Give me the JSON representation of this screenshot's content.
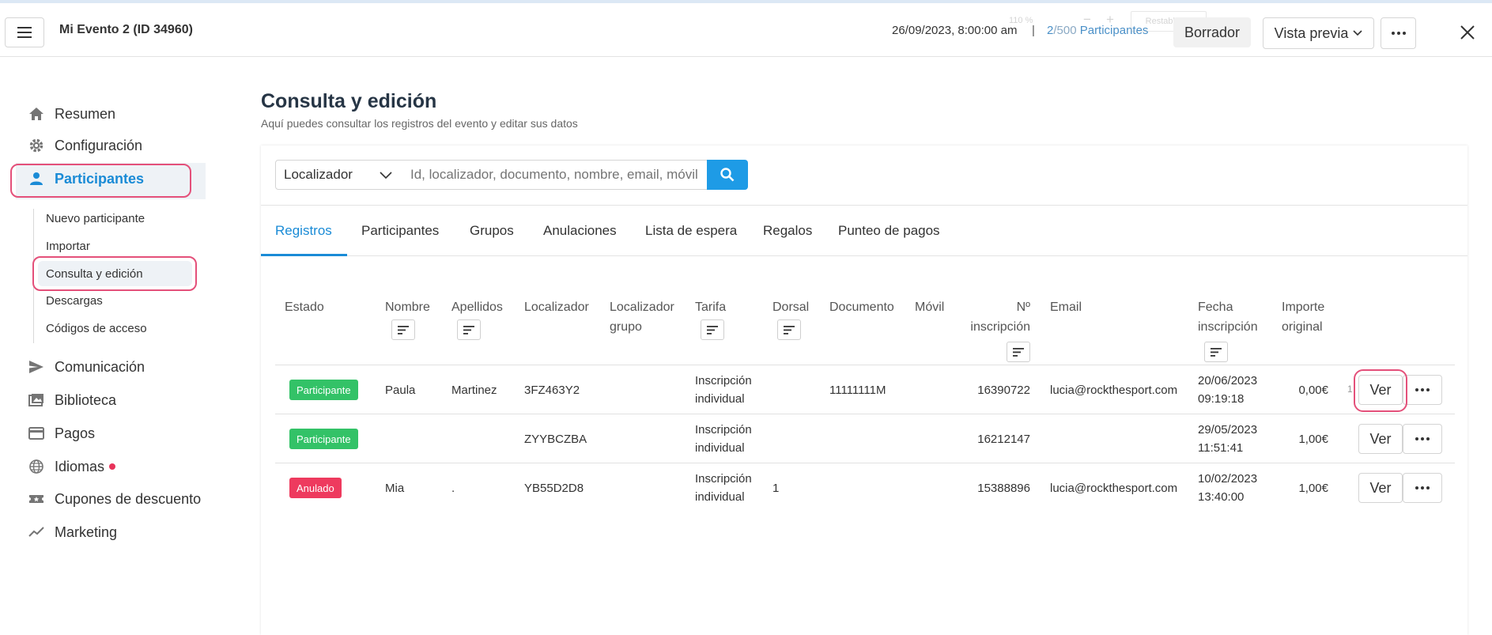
{
  "header": {
    "event_title": "Mi Evento 2 (ID 34960)",
    "date": "26/09/2023, 8:00:00 am",
    "separator": "|",
    "count_current": "2",
    "count_total": "/500",
    "count_label": "Participantes",
    "zoom_level": "110 %",
    "zoom_minus": "−",
    "zoom_plus": "+",
    "zoom_reset": "Restablecer",
    "draft_label": "Borrador",
    "preview_label": "Vista previa"
  },
  "sidebar": {
    "items": [
      {
        "label": "Resumen",
        "icon": "home-icon"
      },
      {
        "label": "Configuración",
        "icon": "gear-icon"
      },
      {
        "label": "Participantes",
        "icon": "person-icon"
      },
      {
        "label": "Comunicación",
        "icon": "send-icon"
      },
      {
        "label": "Biblioteca",
        "icon": "images-icon"
      },
      {
        "label": "Pagos",
        "icon": "card-icon"
      },
      {
        "label": "Idiomas",
        "icon": "globe-icon"
      },
      {
        "label": "Cupones de descuento",
        "icon": "ticket-icon"
      },
      {
        "label": "Marketing",
        "icon": "trend-icon"
      }
    ],
    "subitems": [
      {
        "label": "Nuevo participante"
      },
      {
        "label": "Importar"
      },
      {
        "label": "Consulta y edición"
      },
      {
        "label": "Descargas"
      },
      {
        "label": "Códigos de acceso"
      }
    ]
  },
  "main": {
    "title": "Consulta y edición",
    "subtitle": "Aquí puedes consultar los registros del evento y editar sus datos",
    "search": {
      "filter_value": "Localizador",
      "placeholder": "Id, localizador, documento, nombre, email, móvil"
    },
    "tabs": [
      {
        "label": "Registros"
      },
      {
        "label": "Participantes"
      },
      {
        "label": "Grupos"
      },
      {
        "label": "Anulaciones"
      },
      {
        "label": "Lista de espera"
      },
      {
        "label": "Regalos"
      },
      {
        "label": "Punteo de pagos"
      }
    ],
    "columns": {
      "estado": "Estado",
      "nombre": "Nombre",
      "apellidos": "Apellidos",
      "localizador": "Localizador",
      "localizador_grupo_1": "Localizador",
      "localizador_grupo_2": "grupo",
      "tarifa": "Tarifa",
      "dorsal": "Dorsal",
      "documento": "Documento",
      "movil": "Móvil",
      "inscripcion_1": "Nº",
      "inscripcion_2": "inscripción",
      "email": "Email",
      "fecha_1": "Fecha",
      "fecha_2": "inscripción",
      "importe_1": "Importe",
      "importe_2": "original"
    },
    "rows": [
      {
        "estado": "Participante",
        "estado_color": "#33c267",
        "nombre": "Paula",
        "apellidos": "Martinez",
        "localizador": "3FZ463Y2",
        "tarifa_1": "Inscripción",
        "tarifa_2": "individual",
        "dorsal": "",
        "documento": "11111111M",
        "movil": "",
        "inscripcion": "16390722",
        "email": "lucia@rockthesport.com",
        "fecha_1": "20/06/2023",
        "fecha_2": "09:19:18",
        "importe": "0,00€",
        "overflow": "1",
        "action": "Ver"
      },
      {
        "estado": "Participante",
        "estado_color": "#33c267",
        "nombre": "",
        "apellidos": "",
        "localizador": "ZYYBCZBA",
        "tarifa_1": "Inscripción",
        "tarifa_2": "individual",
        "dorsal": "",
        "documento": "",
        "movil": "",
        "inscripcion": "16212147",
        "email": "",
        "fecha_1": "29/05/2023",
        "fecha_2": "11:51:41",
        "importe": "1,00€",
        "overflow": "",
        "action": "Ver"
      },
      {
        "estado": "Anulado",
        "estado_color": "#ee3a5e",
        "nombre": "Mia",
        "apellidos": ".",
        "localizador": "YB55D2D8",
        "tarifa_1": "Inscripción",
        "tarifa_2": "individual",
        "dorsal": "1",
        "documento": "",
        "movil": "",
        "inscripcion": "15388896",
        "email": "lucia@rockthesport.com",
        "fecha_1": "10/02/2023",
        "fecha_2": "13:40:00",
        "importe": "1,00€",
        "overflow": "",
        "action": "Ver"
      }
    ]
  },
  "colors": {
    "accent": "#1a8bd6",
    "highlight_circle": "#e4507a",
    "status_participante": "#33c267",
    "status_anulado": "#ee3a5e",
    "notification_dot": "#e8335a"
  }
}
